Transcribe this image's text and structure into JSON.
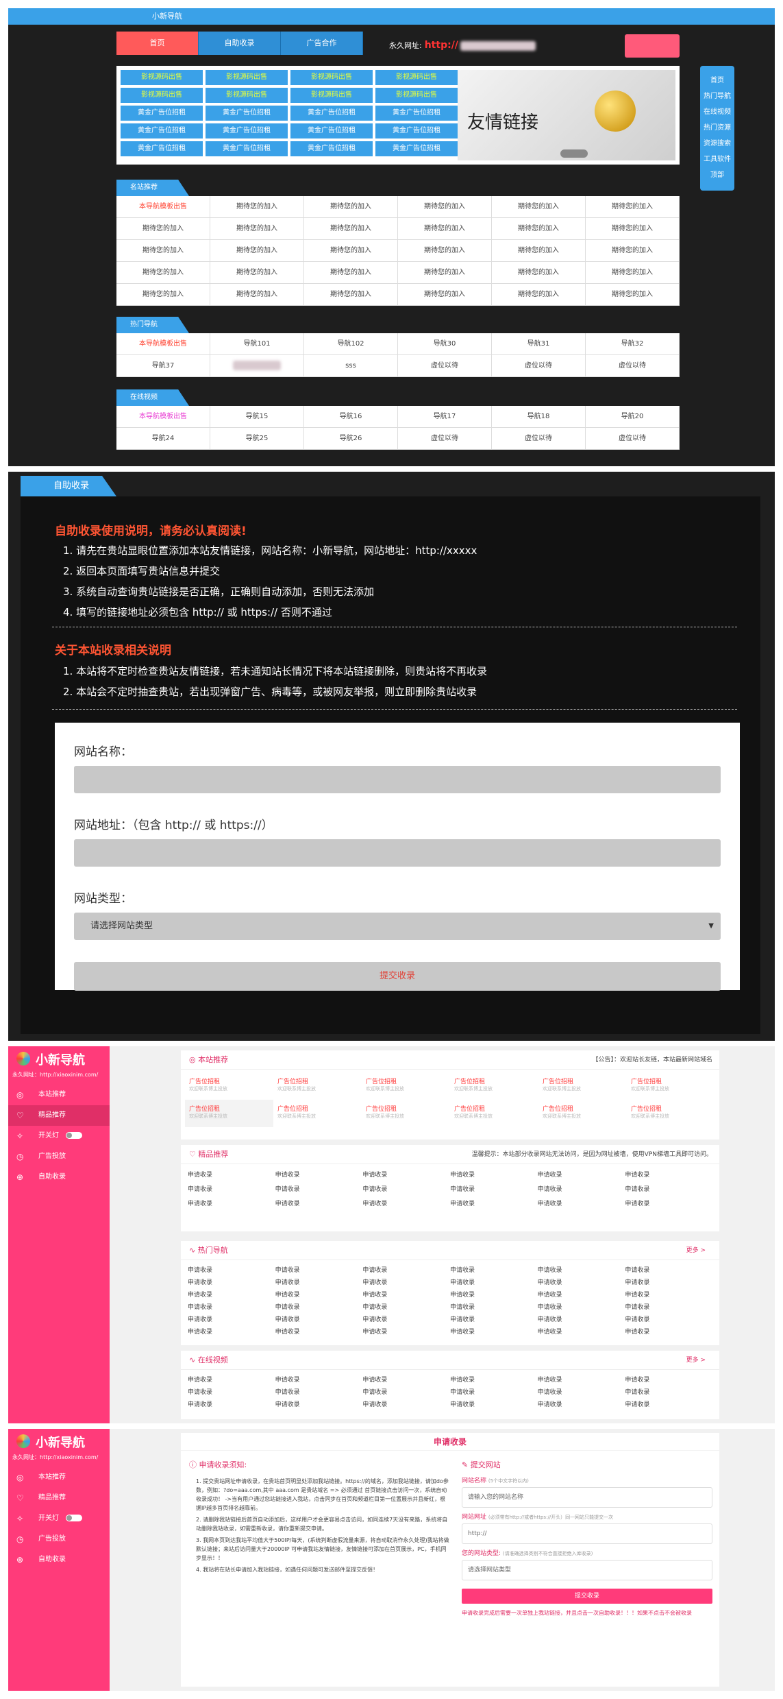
{
  "p1": {
    "top_title": "小新导航",
    "nav": [
      "首页",
      "自助收录",
      "广告合作"
    ],
    "url_label": "永久网址:",
    "url_value": "http://",
    "ads_row_green": [
      "影视源码出售",
      "影视源码出售",
      "影视源码出售",
      "影视源码出售"
    ],
    "ads_row_yellow": [
      "影视源码出售",
      "影视源码出售",
      "影视源码出售",
      "影视源码出售"
    ],
    "ads_gold": "黄金广告位招租",
    "banner_text": "友情链接",
    "side": [
      "首页",
      "热门导航",
      "在线视频",
      "热门资源",
      "资源搜索",
      "工具软件",
      "顶部"
    ],
    "sec1": "名站推荐",
    "sec1_first": "本导航模板出售",
    "sec1_cell": "期待您的加入",
    "sec2": "热门导航",
    "sec2_row1": [
      "本导航模板出售",
      "导航101",
      "导航102",
      "导航30",
      "导航31",
      "导航32"
    ],
    "sec2_row2": [
      "导航37",
      "",
      "sss",
      "虚位以待",
      "虚位以待",
      "虚位以待"
    ],
    "sec3": "在线视频",
    "sec3_row1": [
      "本导航模板出售",
      "导航15",
      "导航16",
      "导航17",
      "导航18",
      "导航20"
    ],
    "sec3_row2": [
      "导航24",
      "导航25",
      "导航26",
      "虚位以待",
      "虚位以待",
      "虚位以待"
    ]
  },
  "p2": {
    "tab": "自助收录",
    "h1": "自助收录使用说明，请务必认真阅读!",
    "li1": [
      "1. 请先在贵站显眼位置添加本站友情链接，网站名称：小新导航，网站地址：http://xxxxx",
      "2. 返回本页面填写贵站信息并提交",
      "3. 系统自动查询贵站链接是否正确，正确则自动添加，否则无法添加",
      "4. 填写的链接地址必须包含 http:// 或 https:// 否则不通过"
    ],
    "h2": "关于本站收录相关说明",
    "li2": [
      "1. 本站将不定时检查贵站友情链接，若未通知站长情况下将本站链接删除，则贵站将不再收录",
      "2. 本站会不定时抽查贵站，若出现弹窗广告、病毒等，或被网友举报，则立即删除贵站收录"
    ],
    "f_name": "网站名称：",
    "f_url": "网站地址：（包含 http:// 或 https://）",
    "f_type": "网站类型：",
    "f_select": "请选择网站类型",
    "f_btn": "提交收录"
  },
  "sb": {
    "logo": "小新导航",
    "url": "永久网址：http://xiaoxinim.com/",
    "items": [
      "本站推荐",
      "精品推荐",
      "开关灯",
      "广告投放",
      "自助收录"
    ]
  },
  "p3": {
    "card1_title": "本站推荐",
    "card1_notice": "【公告】：欢迎站长友链，本站最新网站域名",
    "ad_title": "广告位招租",
    "ad_sub": "欢迎联系博主投放",
    "card2_title": "精品推荐",
    "card2_notice": "温馨提示：本站部分收录网站无法访问，是因为网址被墙，使用VPN梯墙工具即可访问。",
    "cell": "申请收录",
    "card3_title": "热门导航",
    "card4_title": "在线视频",
    "more": "更多 >"
  },
  "p4": {
    "title": "申请收录",
    "left_h": "申请收录须知:",
    "notes": [
      "提交贵站网址申请收录，在贵站首页明显处添加我站链接。https://的域名，添加我站链接，请加do参数，例如：?do=aaa.com,其中 aaa.com 是贵站域名 => 必须通过 首页链接点击访问一次，系统自动收录成功！ ->当有用户通过您站链接进入我站，点击同步在首页和频道栏目第一位置展示并且新红，根据IP越多首页排名越靠前。",
      "请删除我站链接后首页自动添加后，这样用户才会更容易点击访问，如同连续7天没有来路，系统将自动删除我站收录，如需重新收录，请你重新提交申请。",
      "我网本页到达我站平均值大于500IP/每天，(系统判断虚假流量来源，将自动取消作永久处理)我站将做默认链接；来站后访问量大于20000IP 可申请我站友情链接，友情链接可添加在首页展示，PC，手机同步显示！！",
      "我站将在站长申请加入我站链接，如遇任何问题可发送邮件至提交反馈！"
    ],
    "right_h": "提交网站",
    "name_lab": "网站名称",
    "name_hint": "(5个中文字符以内)",
    "name_ph": "请输入您的网站名称",
    "url_lab": "网站网址",
    "url_hint": "(必须带有http://或者https://开头）同一网站只能提交一次",
    "url_ph": "http://",
    "type_lab": "您的网站类型:",
    "type_hint": "(请准确选择类别不符合直接拒绝入库收录)",
    "type_ph": "请选择网站类型",
    "btn": "提交收录",
    "foot": "申请收录完成后需要一次单独上我站链接，并且点击一次自助收录！！！如果不点击不会被收录"
  }
}
